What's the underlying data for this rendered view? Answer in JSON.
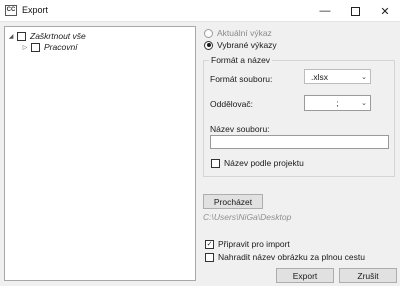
{
  "window": {
    "title": "Export",
    "icon": "cc-app-icon"
  },
  "tree": {
    "root": {
      "label": "Zaškrtnout vše",
      "checked": false,
      "expanded": true
    },
    "children": [
      {
        "label": "Pracovní",
        "checked": false,
        "expanded": false
      }
    ]
  },
  "scope": {
    "options": [
      {
        "label": "Aktuální výkaz",
        "selected": false,
        "enabled": false
      },
      {
        "label": "Vybrané výkazy",
        "selected": true,
        "enabled": true
      }
    ]
  },
  "format_group": {
    "legend": "Formát a název",
    "file_format_label": "Formát souboru:",
    "file_format_value": ".xlsx",
    "separator_label": "Oddělovač:",
    "separator_value": ";",
    "filename_label": "Název souboru:",
    "filename_value": "",
    "name_by_project_label": "Název podle projektu",
    "name_by_project_checked": false
  },
  "browse": {
    "label": "Procházet",
    "path": "C:\\Users\\NiGa\\Desktop"
  },
  "options": {
    "prepare_import_label": "Připravit pro import",
    "prepare_import_checked": true,
    "replace_image_name_label": "Nahradit název obrázku za plnou cestu",
    "replace_image_name_checked": false
  },
  "footer": {
    "export_label": "Export",
    "cancel_label": "Zrušit"
  }
}
